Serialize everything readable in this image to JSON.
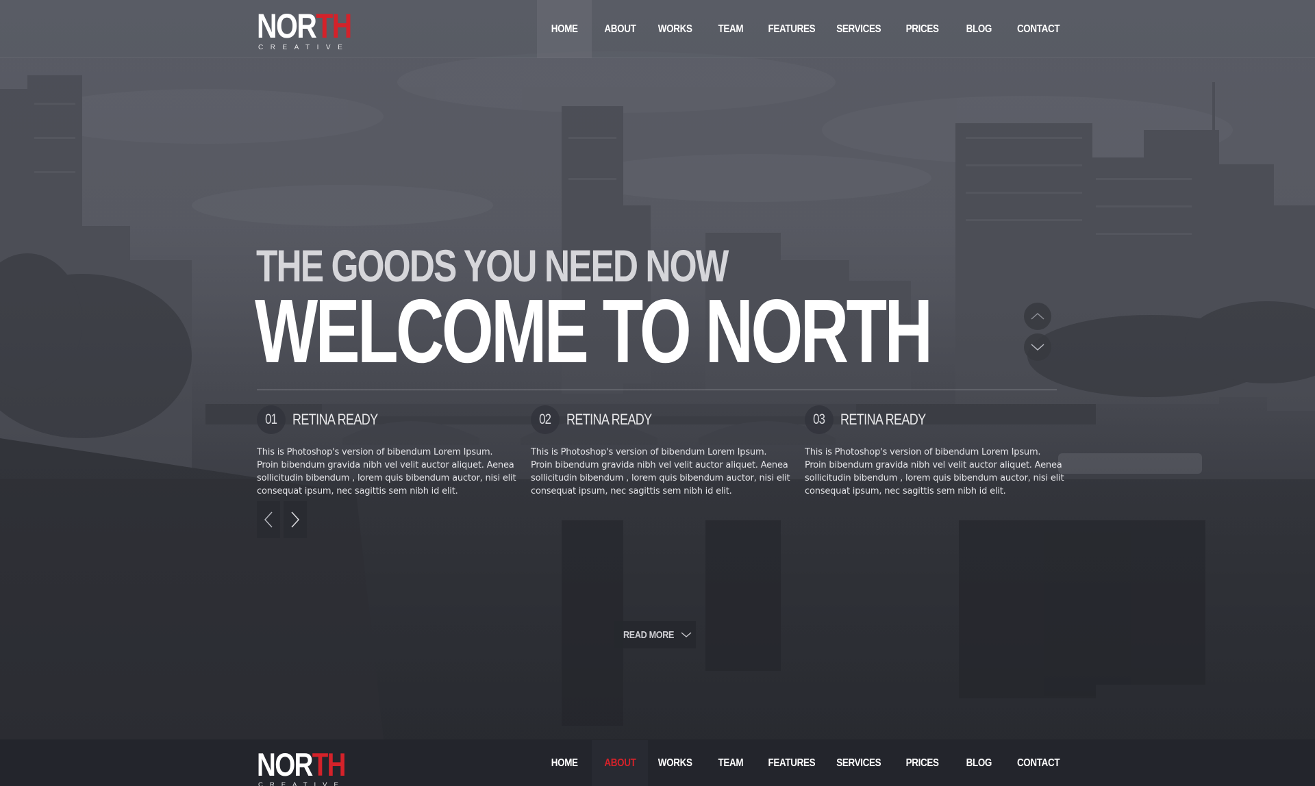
{
  "brand": {
    "name_white": "NOR",
    "name_red": "TH",
    "tagline": "CREATIVE",
    "accent_color": "#d4222a"
  },
  "top_nav": {
    "items": [
      "HOME",
      "ABOUT",
      "WORKS",
      "TEAM",
      "FEATURES",
      "SERVICES",
      "PRICES",
      "BLOG",
      "CONTACT"
    ],
    "highlighted": "HOME"
  },
  "hero": {
    "subtitle": "THE GOODS YOU NEED NOW",
    "title": "WELCOME TO NORTH",
    "read_more": "READ MORE"
  },
  "features": [
    {
      "number": "01",
      "title": "RETINA READY",
      "text": "This is Photoshop's version  of bibendum  Lorem Ipsum.\nProin bibendum  gravida nibh vel velit auctor aliquet. Aenea\n sollicitudin bibendum , lorem quis bibendum auctor, nisi elit\nconsequat ipsum, nec sagittis sem nibh id elit."
    },
    {
      "number": "02",
      "title": "RETINA READY",
      "text": "This is Photoshop's version  of bibendum  Lorem Ipsum.\nProin bibendum  gravida nibh vel velit auctor aliquet. Aenea\n sollicitudin bibendum , lorem quis bibendum auctor, nisi elit\nconsequat ipsum, nec sagittis sem nibh id elit."
    },
    {
      "number": "03",
      "title": "RETINA READY",
      "text": "This is Photoshop's version  of bibendum  Lorem Ipsum.\nProin bibendum  gravida nibh vel velit auctor aliquet. Aenea\n sollicitudin bibendum , lorem quis bibendum auctor, nisi elit\nconsequat ipsum, nec sagittis sem nibh id elit."
    }
  ],
  "bottom_nav": {
    "items": [
      "HOME",
      "ABOUT",
      "WORKS",
      "TEAM",
      "FEATURES",
      "SERVICES",
      "PRICES",
      "BLOG",
      "CONTACT"
    ],
    "current": "ABOUT"
  },
  "icons": {
    "slide_up": "chevron-up-icon",
    "slide_down": "chevron-down-icon",
    "prev": "chevron-left-icon",
    "next": "chevron-right-icon",
    "read_more": "chevron-down-icon"
  }
}
